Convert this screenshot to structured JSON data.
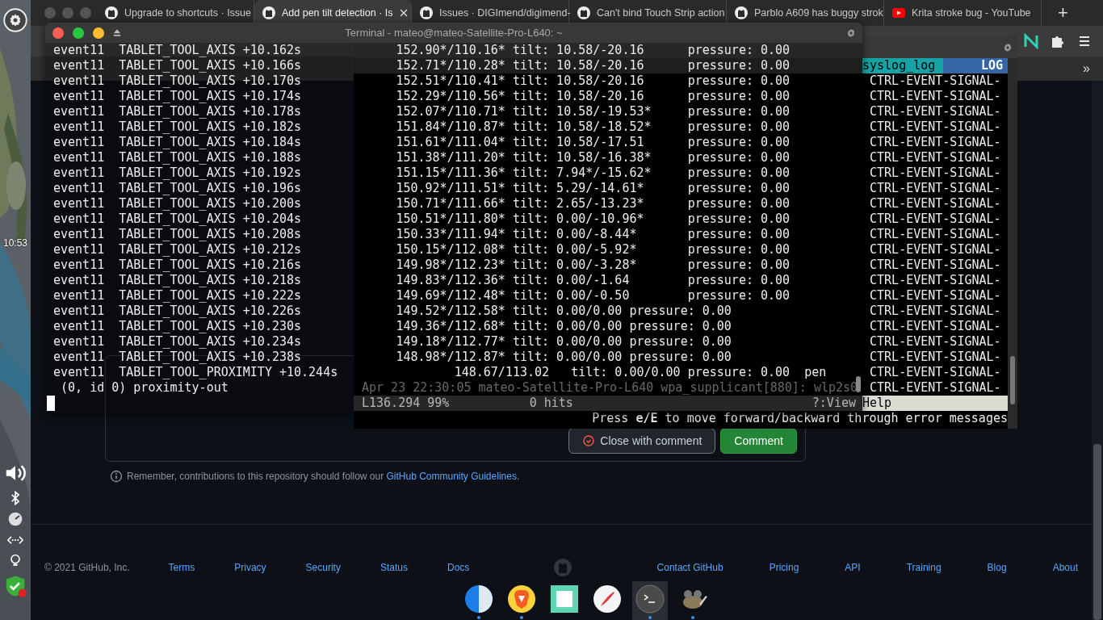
{
  "desktop_panel": {
    "clock": "10:53"
  },
  "browser": {
    "tabs": [
      {
        "title": "Upgrade to shortcuts · Issue",
        "kind": "repo",
        "selected": false
      },
      {
        "title": "Add pen tilt detection · Is",
        "kind": "repo",
        "selected": true
      },
      {
        "title": "Issues · DIGImend/digimend-",
        "kind": "repo",
        "selected": false
      },
      {
        "title": "Can't bind Touch Strip action",
        "kind": "repo",
        "selected": false
      },
      {
        "title": "Parblo A609 has buggy strok",
        "kind": "repo",
        "selected": false
      },
      {
        "title": "Krita stroke bug - YouTube",
        "kind": "video",
        "selected": false
      }
    ],
    "new_tab": "+",
    "bookmarks_overflow": "»",
    "comment_box": {
      "buttons": [
        {
          "label": "Close with comment",
          "kind": "secondary"
        },
        {
          "label": "Comment",
          "kind": "primary"
        }
      ]
    },
    "guidelines_note": {
      "text": "Remember, contributions to this repository should follow our ",
      "link": "GitHub Community Guidelines",
      "end": "."
    },
    "footer": {
      "copyright": "© 2021 GitHub, Inc.",
      "left_links": [
        "Terms",
        "Privacy",
        "Security",
        "Status",
        "Docs"
      ],
      "right_links": [
        "Contact GitHub",
        "Pricing",
        "API",
        "Training",
        "Blog",
        "About"
      ]
    }
  },
  "terminal": {
    "title": "Terminal - mateo@mateo-Satellite-Pro-L640: ~",
    "lines": [
      {
        "kind": "axis",
        "event": "event11  TABLET_TOOL_AXIS +10.162s",
        "values": "152.90*/110.16* tilt: 10.58/-20.16      pressure: 0.00"
      },
      {
        "kind": "axis",
        "event": "event11  TABLET_TOOL_AXIS +10.166s",
        "values": "152.71*/110.28* tilt: 10.58/-20.16      pressure: 0.00"
      },
      {
        "kind": "axis",
        "event": "event11  TABLET_TOOL_AXIS +10.170s",
        "values": "152.51*/110.41* tilt: 10.58/-20.16      pressure: 0.00"
      },
      {
        "kind": "axis",
        "event": "event11  TABLET_TOOL_AXIS +10.174s",
        "values": "152.29*/110.56* tilt: 10.58/-20.16      pressure: 0.00"
      },
      {
        "kind": "axis",
        "event": "event11  TABLET_TOOL_AXIS +10.178s",
        "values": "152.07*/110.71* tilt: 10.58/-19.53*     pressure: 0.00"
      },
      {
        "kind": "axis",
        "event": "event11  TABLET_TOOL_AXIS +10.182s",
        "values": "151.84*/110.87* tilt: 10.58/-18.52*     pressure: 0.00"
      },
      {
        "kind": "axis",
        "event": "event11  TABLET_TOOL_AXIS +10.184s",
        "values": "151.61*/111.04* tilt: 10.58/-17.51      pressure: 0.00"
      },
      {
        "kind": "axis",
        "event": "event11  TABLET_TOOL_AXIS +10.188s",
        "values": "151.38*/111.20* tilt: 10.58/-16.38*     pressure: 0.00"
      },
      {
        "kind": "axis",
        "event": "event11  TABLET_TOOL_AXIS +10.192s",
        "values": "151.15*/111.36* tilt: 7.94*/-15.62*     pressure: 0.00"
      },
      {
        "kind": "axis",
        "event": "event11  TABLET_TOOL_AXIS +10.196s",
        "values": "150.92*/111.51* tilt: 5.29/-14.61*      pressure: 0.00"
      },
      {
        "kind": "axis",
        "event": "event11  TABLET_TOOL_AXIS +10.200s",
        "values": "150.71*/111.66* tilt: 2.65/-13.23*      pressure: 0.00"
      },
      {
        "kind": "axis",
        "event": "event11  TABLET_TOOL_AXIS +10.204s",
        "values": "150.51*/111.80* tilt: 0.00/-10.96*      pressure: 0.00"
      },
      {
        "kind": "axis",
        "event": "event11  TABLET_TOOL_AXIS +10.208s",
        "values": "150.33*/111.94* tilt: 0.00/-8.44*       pressure: 0.00"
      },
      {
        "kind": "axis",
        "event": "event11  TABLET_TOOL_AXIS +10.212s",
        "values": "150.15*/112.08* tilt: 0.00/-5.92*       pressure: 0.00"
      },
      {
        "kind": "axis",
        "event": "event11  TABLET_TOOL_AXIS +10.216s",
        "values": "149.98*/112.23* tilt: 0.00/-3.28*       pressure: 0.00"
      },
      {
        "kind": "axis",
        "event": "event11  TABLET_TOOL_AXIS +10.218s",
        "values": "149.83*/112.36* tilt: 0.00/-1.64        pressure: 0.00"
      },
      {
        "kind": "axis",
        "event": "event11  TABLET_TOOL_AXIS +10.222s",
        "values": "149.69*/112.48* tilt: 0.00/-0.50        pressure: 0.00"
      },
      {
        "kind": "axis",
        "event": "event11  TABLET_TOOL_AXIS +10.226s",
        "values": "149.52*/112.58* tilt: 0.00/0.00 pressure: 0.00"
      },
      {
        "kind": "axis",
        "event": "event11  TABLET_TOOL_AXIS +10.230s",
        "values": "149.36*/112.68* tilt: 0.00/0.00 pressure: 0.00"
      },
      {
        "kind": "axis",
        "event": "event11  TABLET_TOOL_AXIS +10.234s",
        "values": "149.18*/112.77* tilt: 0.00/0.00 pressure: 0.00"
      },
      {
        "kind": "axis",
        "event": "event11  TABLET_TOOL_AXIS +10.238s",
        "values": "148.98*/112.87* tilt: 0.00/0.00 pressure: 0.00"
      },
      {
        "kind": "proximity",
        "event": "event11  TABLET_TOOL_PROXIMITY +10.244s",
        "values": "148.67/113.02   tilt: 0.00/0.00 pressure: 0.00  pen"
      },
      {
        "kind": "detail",
        "event": "(0, id 0) proximity-out"
      }
    ]
  },
  "log_viewer": {
    "file_label": "syslog_log",
    "level_label": "LOG",
    "entries": [
      "CTRL-EVENT-SIGNAL-",
      "CTRL-EVENT-SIGNAL-",
      "CTRL-EVENT-SIGNAL-",
      "CTRL-EVENT-SIGNAL-",
      "CTRL-EVENT-SIGNAL-",
      "CTRL-EVENT-SIGNAL-",
      "CTRL-EVENT-SIGNAL-",
      "CTRL-EVENT-SIGNAL-",
      "CTRL-EVENT-SIGNAL-",
      "CTRL-EVENT-SIGNAL-",
      "CTRL-EVENT-SIGNAL-",
      "CTRL-EVENT-SIGNAL-",
      "CTRL-EVENT-SIGNAL-",
      "CTRL-EVENT-SIGNAL-",
      "CTRL-EVENT-SIGNAL-",
      "CTRL-EVENT-SIGNAL-",
      "CTRL-EVENT-SIGNAL-",
      "CTRL-EVENT-SIGNAL-",
      "CTRL-EVENT-SIGNAL-",
      "CTRL-EVENT-SIGNAL-",
      "CTRL-EVENT-SIGNAL-"
    ],
    "last_line": "Apr 23 22:30:05 mateo-Satellite-Pro-L640 wpa_supplicant[880]: wlp2s0",
    "status": {
      "line": "L136.294",
      "percent": "99%",
      "hits": "0 hits",
      "view_hint": "?:View"
    },
    "help": "Help",
    "message": "Press **e/E** to move forward/backward through error messages"
  },
  "dock": [
    {
      "kind": "finder",
      "running": true,
      "selected": false
    },
    {
      "kind": "brave",
      "running": true,
      "selected": false
    },
    {
      "kind": "notes",
      "running": false,
      "selected": false
    },
    {
      "kind": "paint",
      "running": false,
      "selected": false
    },
    {
      "kind": "terminal",
      "running": true,
      "selected": true
    },
    {
      "kind": "gimp",
      "running": true,
      "selected": false
    }
  ]
}
